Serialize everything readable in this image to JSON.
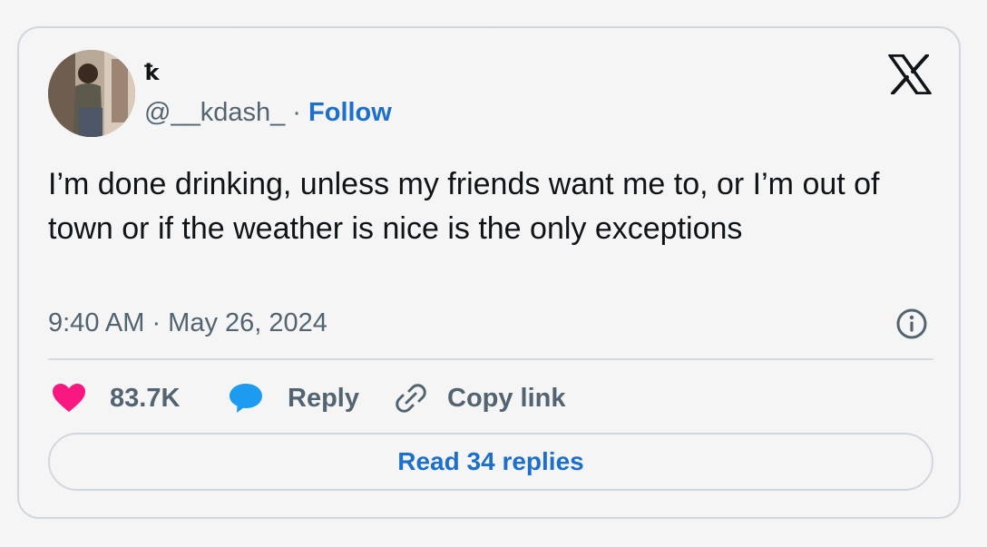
{
  "author": {
    "display_name": "ꝁ",
    "handle": "@__kdash_",
    "separator": "·",
    "follow_label": "Follow"
  },
  "tweet": {
    "text": "I’m done drinking, unless my friends want me to, or I’m out of town or if the weather is nice is the only exceptions",
    "timestamp": "9:40 AM · May 26, 2024"
  },
  "actions": {
    "like_count": "83.7K",
    "reply_label": "Reply",
    "copy_link_label": "Copy link"
  },
  "read_replies_label": "Read 34 replies",
  "colors": {
    "like": "#f91880",
    "reply": "#1d9bf0",
    "link": "#1d6fcc",
    "muted": "#536471",
    "text": "#0f1419"
  },
  "icons": {
    "brand": "x-logo-icon",
    "info": "info-icon",
    "like": "heart-icon",
    "reply": "speech-bubble-icon",
    "copy": "link-icon"
  }
}
